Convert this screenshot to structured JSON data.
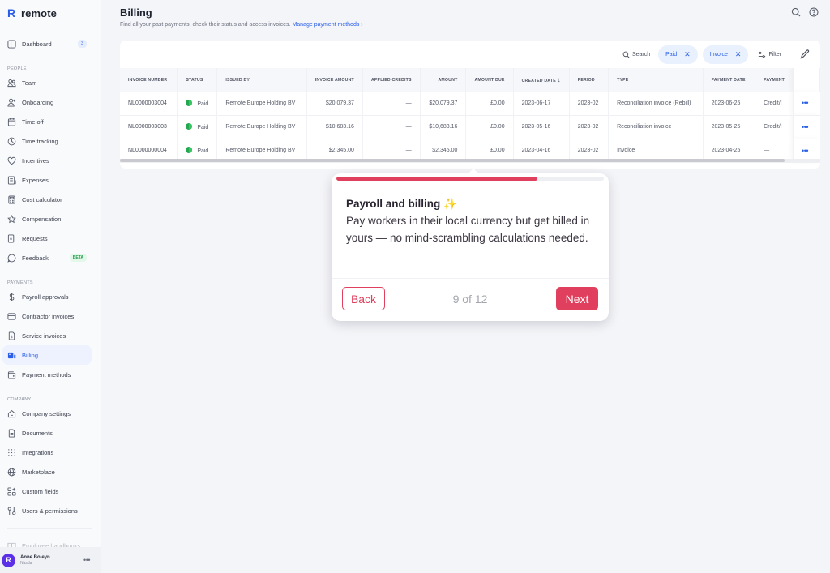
{
  "app": {
    "logo_text": "remote",
    "logo_mark": "R"
  },
  "header": {
    "title": "Billing",
    "subtitle": "Find all your past payments, check their status and access invoices.",
    "subtitle_link": "Manage payment methods ›",
    "icons": [
      "search-icon",
      "help-icon"
    ]
  },
  "sidebar": {
    "dashboard": {
      "label": "Dashboard",
      "badge": "3",
      "icon": "dashboard-icon"
    },
    "sections": [
      {
        "title": "PEOPLE",
        "items": [
          {
            "label": "Team",
            "icon": "team-icon"
          },
          {
            "label": "Onboarding",
            "icon": "onboarding-icon"
          },
          {
            "label": "Time off",
            "icon": "calendar-icon"
          },
          {
            "label": "Time tracking",
            "icon": "clock-icon"
          },
          {
            "label": "Incentives",
            "icon": "heart-icon"
          },
          {
            "label": "Expenses",
            "icon": "receipt-icon"
          },
          {
            "label": "Cost calculator",
            "icon": "calculator-icon"
          },
          {
            "label": "Compensation",
            "icon": "star-icon"
          },
          {
            "label": "Requests",
            "icon": "requests-icon"
          },
          {
            "label": "Feedback",
            "icon": "chat-icon",
            "badge": "BETA"
          }
        ]
      },
      {
        "title": "PAYMENTS",
        "items": [
          {
            "label": "Payroll approvals",
            "icon": "dollar-icon"
          },
          {
            "label": "Contractor invoices",
            "icon": "card-icon"
          },
          {
            "label": "Service invoices",
            "icon": "invoice-icon"
          },
          {
            "label": "Billing",
            "icon": "billing-icon",
            "active": true
          },
          {
            "label": "Payment methods",
            "icon": "wallet-icon"
          }
        ]
      },
      {
        "title": "COMPANY",
        "items": [
          {
            "label": "Company settings",
            "icon": "building-icon"
          },
          {
            "label": "Documents",
            "icon": "document-icon"
          },
          {
            "label": "Integrations",
            "icon": "grid-icon"
          },
          {
            "label": "Marketplace",
            "icon": "globe-icon"
          },
          {
            "label": "Custom fields",
            "icon": "custom-fields-icon"
          },
          {
            "label": "Users & permissions",
            "icon": "permissions-icon"
          }
        ]
      }
    ],
    "faded_item": {
      "label": "Employee handbooks",
      "icon": "book-icon"
    },
    "user": {
      "name": "Anne Boleyn",
      "role": "Nasda",
      "avatar_letter": "R"
    }
  },
  "toolbar": {
    "search_label": "Search",
    "chips": [
      {
        "label": "Paid"
      },
      {
        "label": "Invoice"
      }
    ],
    "filter_label": "Filter"
  },
  "table": {
    "columns": [
      "INVOICE NUMBER",
      "STATUS",
      "ISSUED BY",
      "INVOICE AMOUNT",
      "APPLIED CREDITS",
      "AMOUNT",
      "AMOUNT DUE",
      "CREATED DATE",
      "PERIOD",
      "TYPE",
      "PAYMENT DATE",
      "PAYMENT"
    ],
    "sort_indicator": "↓",
    "rows": [
      {
        "invoice_number": "NL0000003004",
        "status": "Paid",
        "issued_by": "Remote Europe Holding BV",
        "invoice_amount": "$20,079.37",
        "applied_credits": "—",
        "amount": "$20,079.37",
        "amount_due": "£0.00",
        "created_date": "2023-06-17",
        "period": "2023-02",
        "type": "Reconciliation invoice (Rebill)",
        "payment_date": "2023-06-25",
        "payment": "Credit/I"
      },
      {
        "invoice_number": "NL0000003003",
        "status": "Paid",
        "issued_by": "Remote Europe Holding BV",
        "invoice_amount": "$10,683.16",
        "applied_credits": "—",
        "amount": "$10,683.16",
        "amount_due": "£0.00",
        "created_date": "2023-05-16",
        "period": "2023-02",
        "type": "Reconciliation invoice",
        "payment_date": "2023-05-25",
        "payment": "Credit/I"
      },
      {
        "invoice_number": "NL0000000004",
        "status": "Paid",
        "issued_by": "Remote Europe Holding BV",
        "invoice_amount": "$2,345.00",
        "applied_credits": "—",
        "amount": "$2,345.00",
        "amount_due": "£0.00",
        "created_date": "2023-04-16",
        "period": "2023-02",
        "type": "Invoice",
        "payment_date": "2023-04-25",
        "payment": "—"
      }
    ],
    "row_action": "•••"
  },
  "tour": {
    "title": "Payroll and billing",
    "sparkle": "✨",
    "body": "Pay workers in their local currency but get billed in yours — no mind-scrambling calculations needed.",
    "back_label": "Back",
    "next_label": "Next",
    "step_text": "9 of 12",
    "progress_percent": 75,
    "accent_color": "#e0405d"
  },
  "colors": {
    "brand_blue": "#2a5ee8",
    "paid_green": "#22a94f",
    "tour_accent": "#e0405d"
  }
}
